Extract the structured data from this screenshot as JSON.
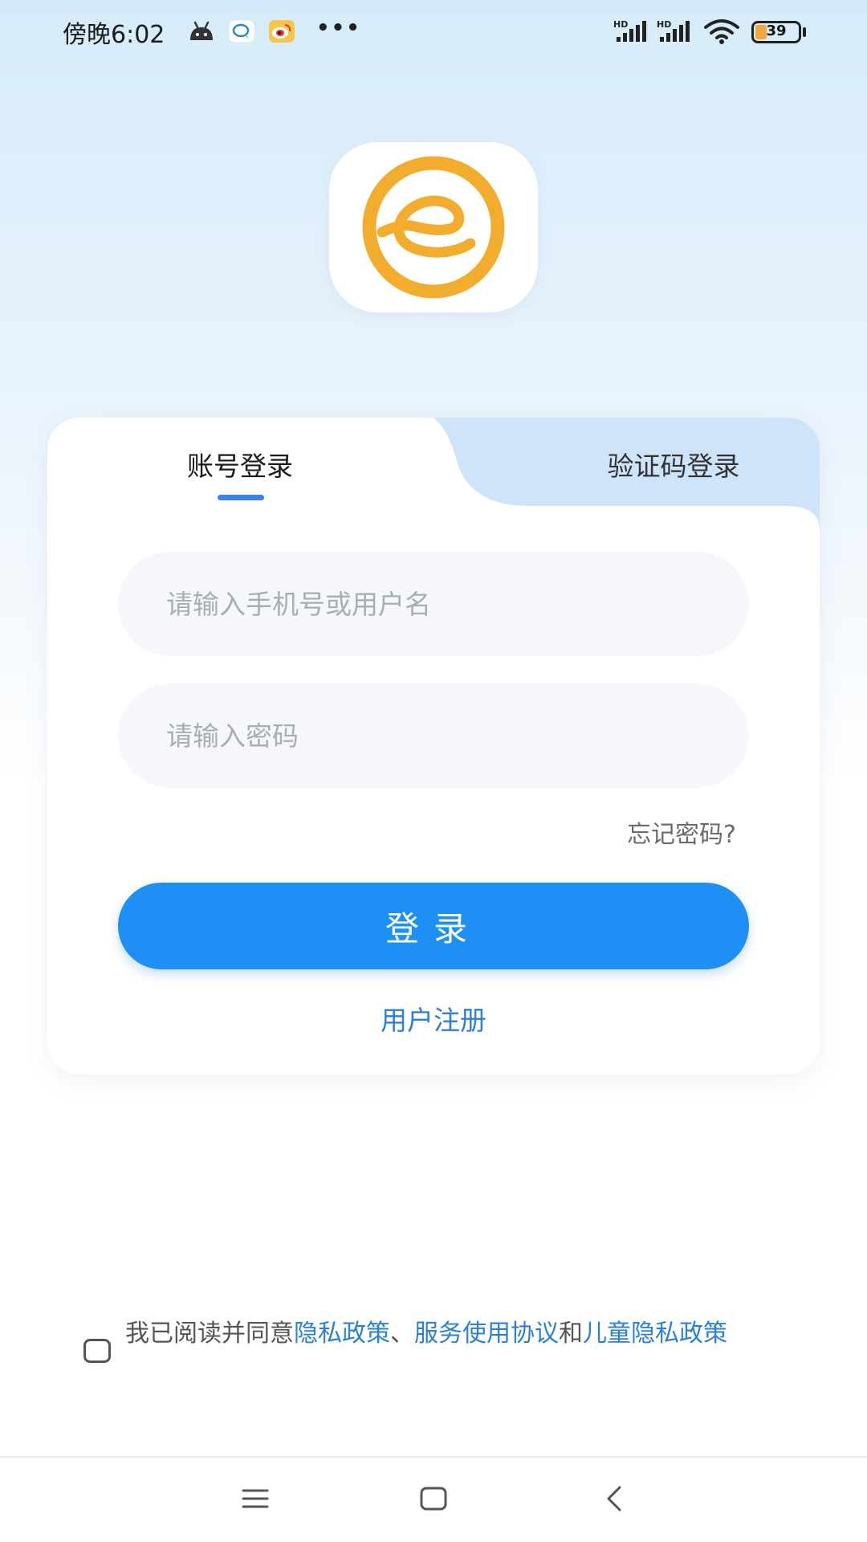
{
  "status_bar": {
    "time": "傍晚6:02",
    "more_glyph": "•••",
    "signal_1_label": "HD",
    "signal_2_label": "HD",
    "battery_level": "39"
  },
  "tabs": {
    "account_label": "账号登录",
    "code_label": "验证码登录",
    "active": "账号登录"
  },
  "form": {
    "phone_placeholder": "请输入手机号或用户名",
    "phone_value": "",
    "password_placeholder": "请输入密码",
    "password_value": "",
    "forgot_label": "忘记密码?",
    "login_label": "登录",
    "register_label": "用户注册"
  },
  "agreement": {
    "checked": false,
    "prefix": "我已阅读并同意",
    "privacy_link": "隐私政策",
    "separator": "、",
    "service_link": "服务使用协议",
    "and": "和",
    "child_link": "儿童隐私政策"
  },
  "colors": {
    "primary": "#1e90f5",
    "link": "#2b7fd6",
    "logo": "#f2ad2e",
    "tab_inactive_bg": "#cde4fb"
  },
  "icons": {
    "logo": "elephant-e-logo-icon",
    "nav_menu": "menu-icon",
    "nav_home": "home-square-icon",
    "nav_back": "back-chevron-icon"
  }
}
